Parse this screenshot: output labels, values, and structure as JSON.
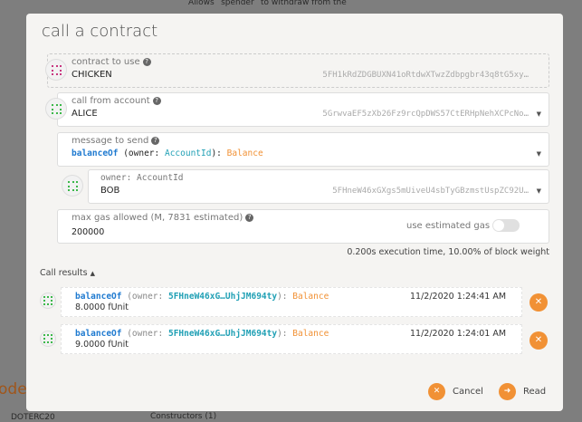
{
  "background": {
    "top_text": "Allows `spender` to withdraw from the",
    "bottom_left": "ode",
    "contract_name": "DOTERC20",
    "constructors": "Constructors (1)"
  },
  "modal": {
    "title": "call a contract",
    "contract": {
      "label": "contract to use",
      "name": "CHICKEN",
      "address": "5FH1kRdZDGBUXN41oRtdwXTwzZdbpgbr43q8tG5xy…"
    },
    "account": {
      "label": "call from account",
      "name": "ALICE",
      "address": "5GrwvaEF5zXb26Fz9rcQpDWS57CtERHpNehXCPcNo…"
    },
    "message": {
      "label": "message to send",
      "fn": "balanceOf",
      "open": " (owner: ",
      "type": "AccountId",
      "close": "): ",
      "ret": "Balance"
    },
    "owner": {
      "label": "owner: AccountId",
      "name": "BOB",
      "address": "5FHneW46xGXgs5mUiveU4sbTyGBzmstUspZC92U…"
    },
    "gas": {
      "label": "max gas allowed (M, 7831 estimated)",
      "value": "200000",
      "toggle_label": "use estimated gas",
      "toggle_on": false
    },
    "weight_info": "0.200s execution time, 10.00% of block weight",
    "results_label": "Call results",
    "results": [
      {
        "fn": "balanceOf",
        "open": " (owner: ",
        "arg": "5FHneW46xG…UhjJM694ty",
        "close": "): ",
        "ret": "Balance",
        "value": "8.0000 fUnit",
        "time": "11/2/2020 1:24:41 AM"
      },
      {
        "fn": "balanceOf",
        "open": " (owner: ",
        "arg": "5FHneW46xG…UhjJM694ty",
        "close": "): ",
        "ret": "Balance",
        "value": "9.0000 fUnit",
        "time": "11/2/2020 1:24:01 AM"
      }
    ],
    "cancel_label": "Cancel",
    "read_label": "Read"
  }
}
